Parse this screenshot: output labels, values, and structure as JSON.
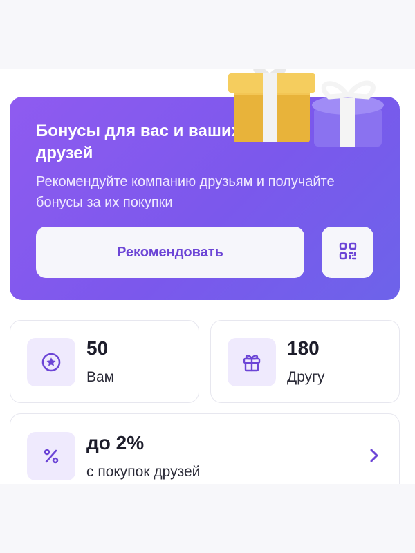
{
  "promo": {
    "title": "Бонусы для вас и ваших друзей",
    "description": "Рекомендуйте компанию друзьям и получайте бонусы за их покупки",
    "recommend_label": "Рекомендовать"
  },
  "stats": [
    {
      "value": "50",
      "label": "Вам",
      "icon": "star-badge-icon"
    },
    {
      "value": "180",
      "label": "Другу",
      "icon": "gift-icon"
    }
  ],
  "referral_rate": {
    "value": "до 2%",
    "label": "с покупок друзей",
    "icon": "percent-icon"
  },
  "colors": {
    "accent": "#6c45d6",
    "promo_gradient_start": "#8f5bf0",
    "promo_gradient_end": "#6d63ea",
    "icon_bg": "#efeafd"
  }
}
